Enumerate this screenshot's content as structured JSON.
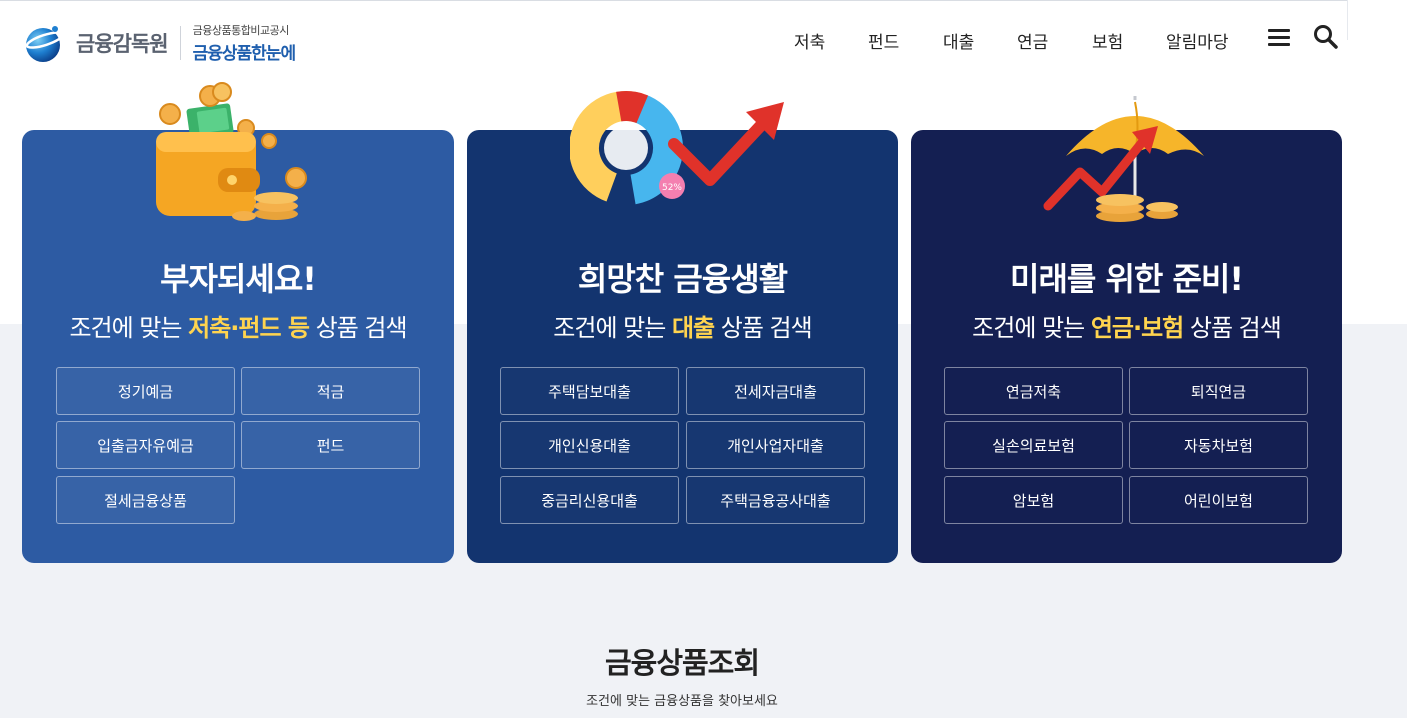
{
  "header": {
    "logo_text": "금융감독원",
    "logo_sub_small": "금융상품통합비교공시",
    "logo_sub_big": "금융상품한눈에",
    "nav": [
      "저축",
      "펀드",
      "대출",
      "연금",
      "보험",
      "알림마당"
    ]
  },
  "cards": [
    {
      "title": "부자되세요!",
      "sub_before": "조건에 맞는 ",
      "sub_highlight": "저축·펀드 등",
      "sub_after": " 상품 검색",
      "buttons": [
        "정기예금",
        "적금",
        "입출금자유예금",
        "펀드",
        "절세금융상품"
      ]
    },
    {
      "title": "희망찬 금융생활",
      "sub_before": "조건에 맞는 ",
      "sub_highlight": "대출",
      "sub_after": " 상품 검색",
      "buttons": [
        "주택담보대출",
        "전세자금대출",
        "개인신용대출",
        "개인사업자대출",
        "중금리신용대출",
        "주택금융공사대출"
      ]
    },
    {
      "title": "미래를 위한 준비!",
      "sub_before": "조건에 맞는 ",
      "sub_highlight": "연금·보험",
      "sub_after": " 상품 검색",
      "buttons": [
        "연금저축",
        "퇴직연금",
        "실손의료보험",
        "자동차보험",
        "암보험",
        "어린이보험"
      ]
    }
  ],
  "chart_badge": "52%",
  "section": {
    "title": "금융상품조회",
    "subtitle": "조건에 맞는 금융상품을 찾아보세요"
  },
  "colors": {
    "card1": "#2d5ba3",
    "card2": "#13346f",
    "card3": "#141f52",
    "highlight": "#ffd44f",
    "brand_blue": "#1f5fae"
  },
  "icons": [
    "globe-logo-icon",
    "menu-icon",
    "search-icon",
    "wallet-coins-icon",
    "donut-chart-arrow-icon",
    "umbrella-coins-icon"
  ]
}
